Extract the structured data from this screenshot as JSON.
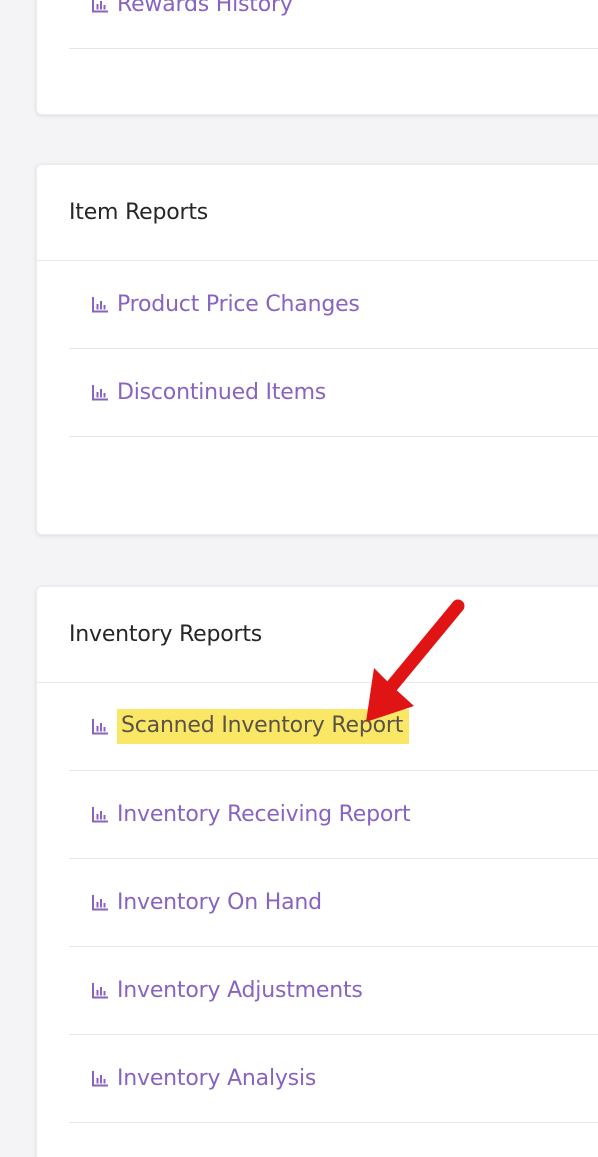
{
  "colors": {
    "link": "#8863c2",
    "highlight": "#fbe766",
    "arrow": "#e01414"
  },
  "top_section": {
    "partial_item_label": "Rewards History"
  },
  "item_reports": {
    "title": "Item Reports",
    "items": [
      {
        "label": "Product Price Changes",
        "icon": "bar-chart-icon"
      },
      {
        "label": "Discontinued Items",
        "icon": "bar-chart-icon"
      }
    ]
  },
  "inventory_reports": {
    "title": "Inventory Reports",
    "items": [
      {
        "label": "Scanned Inventory Report",
        "icon": "bar-chart-icon",
        "highlighted": true
      },
      {
        "label": "Inventory Receiving Report",
        "icon": "bar-chart-icon"
      },
      {
        "label": "Inventory On Hand",
        "icon": "bar-chart-icon"
      },
      {
        "label": "Inventory Adjustments",
        "icon": "bar-chart-icon"
      },
      {
        "label": "Inventory Analysis",
        "icon": "bar-chart-icon"
      }
    ]
  }
}
